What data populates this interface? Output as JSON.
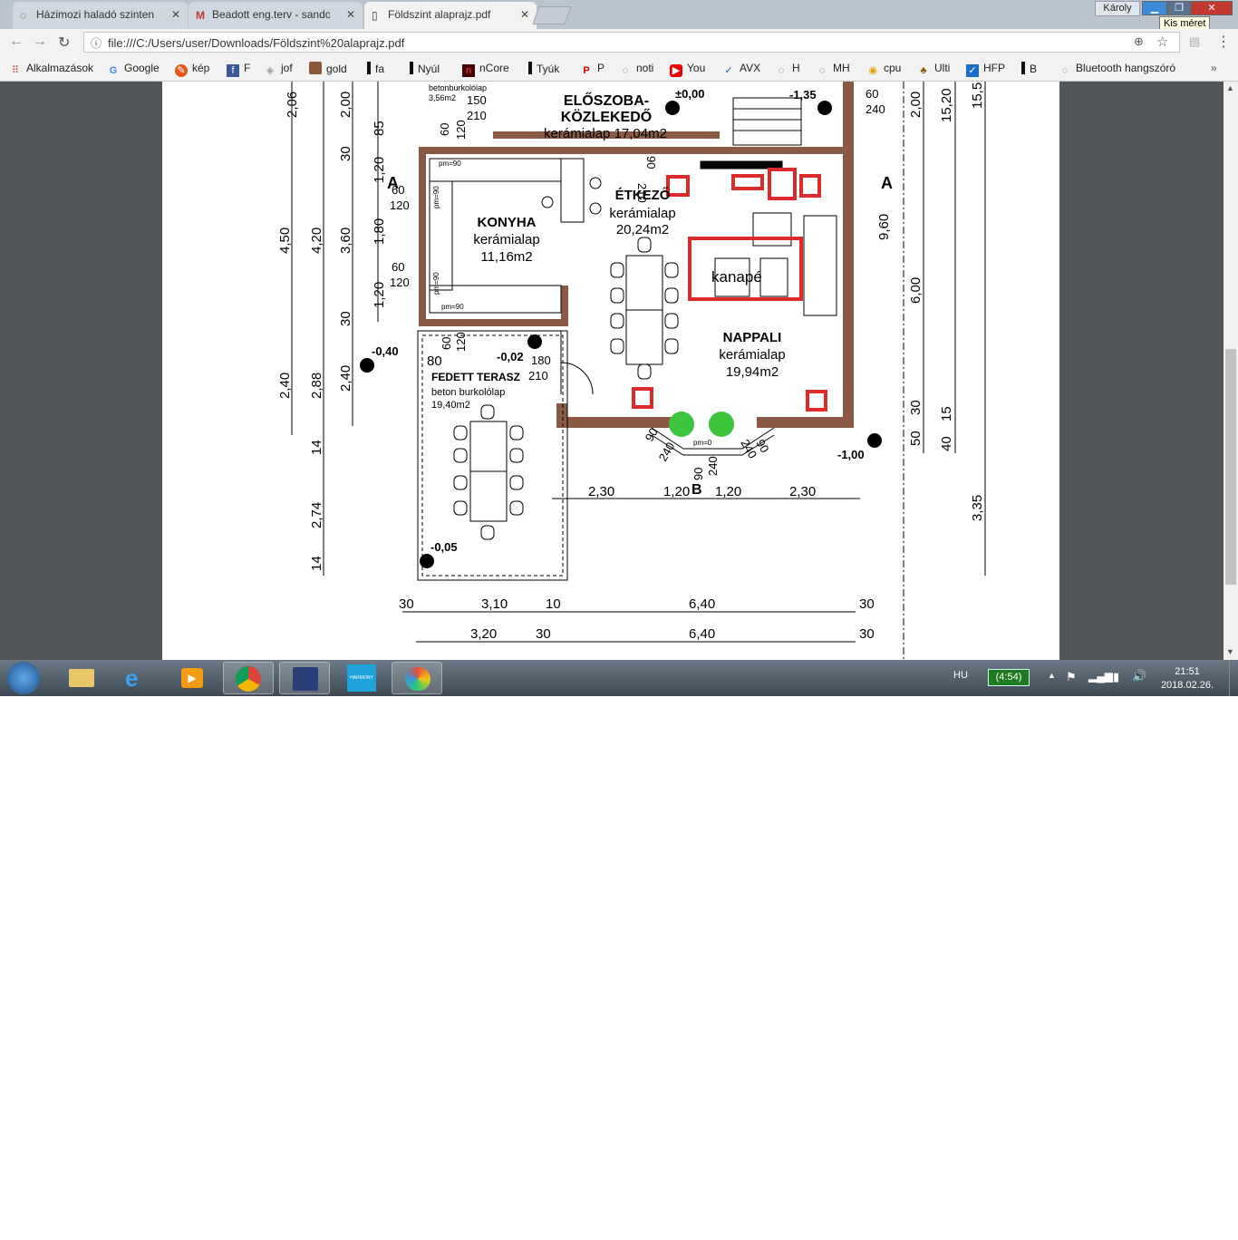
{
  "browser": {
    "tabs": [
      {
        "label": "Házimozi haladó szinten",
        "icon": "forum-icon"
      },
      {
        "label": "Beadott eng.terv - sando",
        "icon": "gmail-icon"
      },
      {
        "label": "Földszint alaprajz.pdf",
        "icon": "document-icon"
      }
    ],
    "profile_name": "Károly",
    "tooltip": "Kis méret",
    "url": "file:///C:/Users/user/Downloads/Földszint%20alaprajz.pdf",
    "bookmarks": [
      {
        "label": "Alkalmazások",
        "icon": "apps-grid-icon"
      },
      {
        "label": "Google",
        "icon": "google-icon"
      },
      {
        "label": "kép",
        "icon": "image-icon"
      },
      {
        "label": "F",
        "icon": "facebook-icon"
      },
      {
        "label": "jof",
        "icon": "cube-icon"
      },
      {
        "label": "gold",
        "icon": "avatar-icon"
      },
      {
        "label": "fa",
        "icon": "bookmark-icon"
      },
      {
        "label": "Nyúl",
        "icon": "bookmark-icon"
      },
      {
        "label": "nCore",
        "icon": "ncore-icon"
      },
      {
        "label": "Tyúk",
        "icon": "bookmark-icon"
      },
      {
        "label": "P",
        "icon": "pinterest-icon"
      },
      {
        "label": "noti",
        "icon": "forum-icon"
      },
      {
        "label": "You",
        "icon": "youtube-icon"
      },
      {
        "label": "AVX",
        "icon": "avx-icon"
      },
      {
        "label": "H",
        "icon": "forum-icon"
      },
      {
        "label": "MH",
        "icon": "forum-icon"
      },
      {
        "label": "cpu",
        "icon": "cpu-icon"
      },
      {
        "label": "Ulti",
        "icon": "cards-icon"
      },
      {
        "label": "HFP",
        "icon": "hfp-icon"
      },
      {
        "label": "B",
        "icon": "bookmark-icon"
      },
      {
        "label": "Bluetooth hangszóró",
        "icon": "forum-icon"
      }
    ]
  },
  "plan": {
    "rooms": {
      "eloszoba_title1": "ELŐSZOBA-",
      "eloszoba_title2": "KÖZLEKEDŐ",
      "eloszoba_floor": "kerámialap 17,04m2",
      "etkezo_title": "ÉTKEZŐ",
      "etkezo_floor": "kerámialap",
      "etkezo_area": "20,24m2",
      "konyha_title": "KONYHA",
      "konyha_floor": "kerámialap",
      "konyha_area": "11,16m2",
      "nappali_title": "NAPPALI",
      "nappali_floor": "kerámialap",
      "nappali_area": "19,94m2",
      "terasz_title": "FEDETT TERASZ",
      "terasz_floor": "beton burkolólap",
      "terasz_area": "19,40m2",
      "wc_floor": "betonburkolólap",
      "wc_area": "3,56m2"
    },
    "annotation_kanape": "kanapé",
    "levels": [
      "±0,00",
      "-1,35",
      "-0,40",
      "-0,02",
      "-1,00",
      "-0,05"
    ],
    "section_marks": [
      "A",
      "A",
      "B"
    ],
    "dims_left": [
      "2,06",
      "2,00",
      "85",
      "30",
      "1,20",
      "4,50",
      "4,20",
      "3,60",
      "1,80",
      "1,20",
      "30",
      "2,40",
      "2,88",
      "2,40",
      "14",
      "2,74",
      "14"
    ],
    "dims_right": [
      "2,00",
      "15,20",
      "15,50",
      "9,60",
      "6,00",
      "30",
      "15",
      "50",
      "40",
      "3,35"
    ],
    "dims_bottom_row1": [
      "2,30",
      "1,20",
      "1,20",
      "2,30"
    ],
    "dims_bottom_row2": [
      "30",
      "3,10",
      "10",
      "6,40",
      "30"
    ],
    "dims_bottom_row3": [
      "3,20",
      "30",
      "6,40",
      "30"
    ],
    "openings": [
      "150",
      "210",
      "60",
      "120",
      "60",
      "240",
      "60",
      "120",
      "60",
      "120",
      "60",
      "120",
      "80",
      "180",
      "210",
      "90",
      "240",
      "90",
      "240",
      "90",
      "240",
      "210",
      "90"
    ],
    "pm_labels": [
      "pm=90",
      "pm=90",
      "pm=90",
      "pm=90",
      "pm=0"
    ]
  },
  "taskbar": {
    "language": "HU",
    "battery": "(4:54)",
    "time": "21:51",
    "date": "2018.02.26.",
    "apps": [
      "start-orb-icon",
      "explorer-icon",
      "internet-explorer-icon",
      "media-player-icon",
      "chrome-icon",
      "floppy-save-icon",
      "harmony-icon",
      "paint-icon"
    ]
  }
}
